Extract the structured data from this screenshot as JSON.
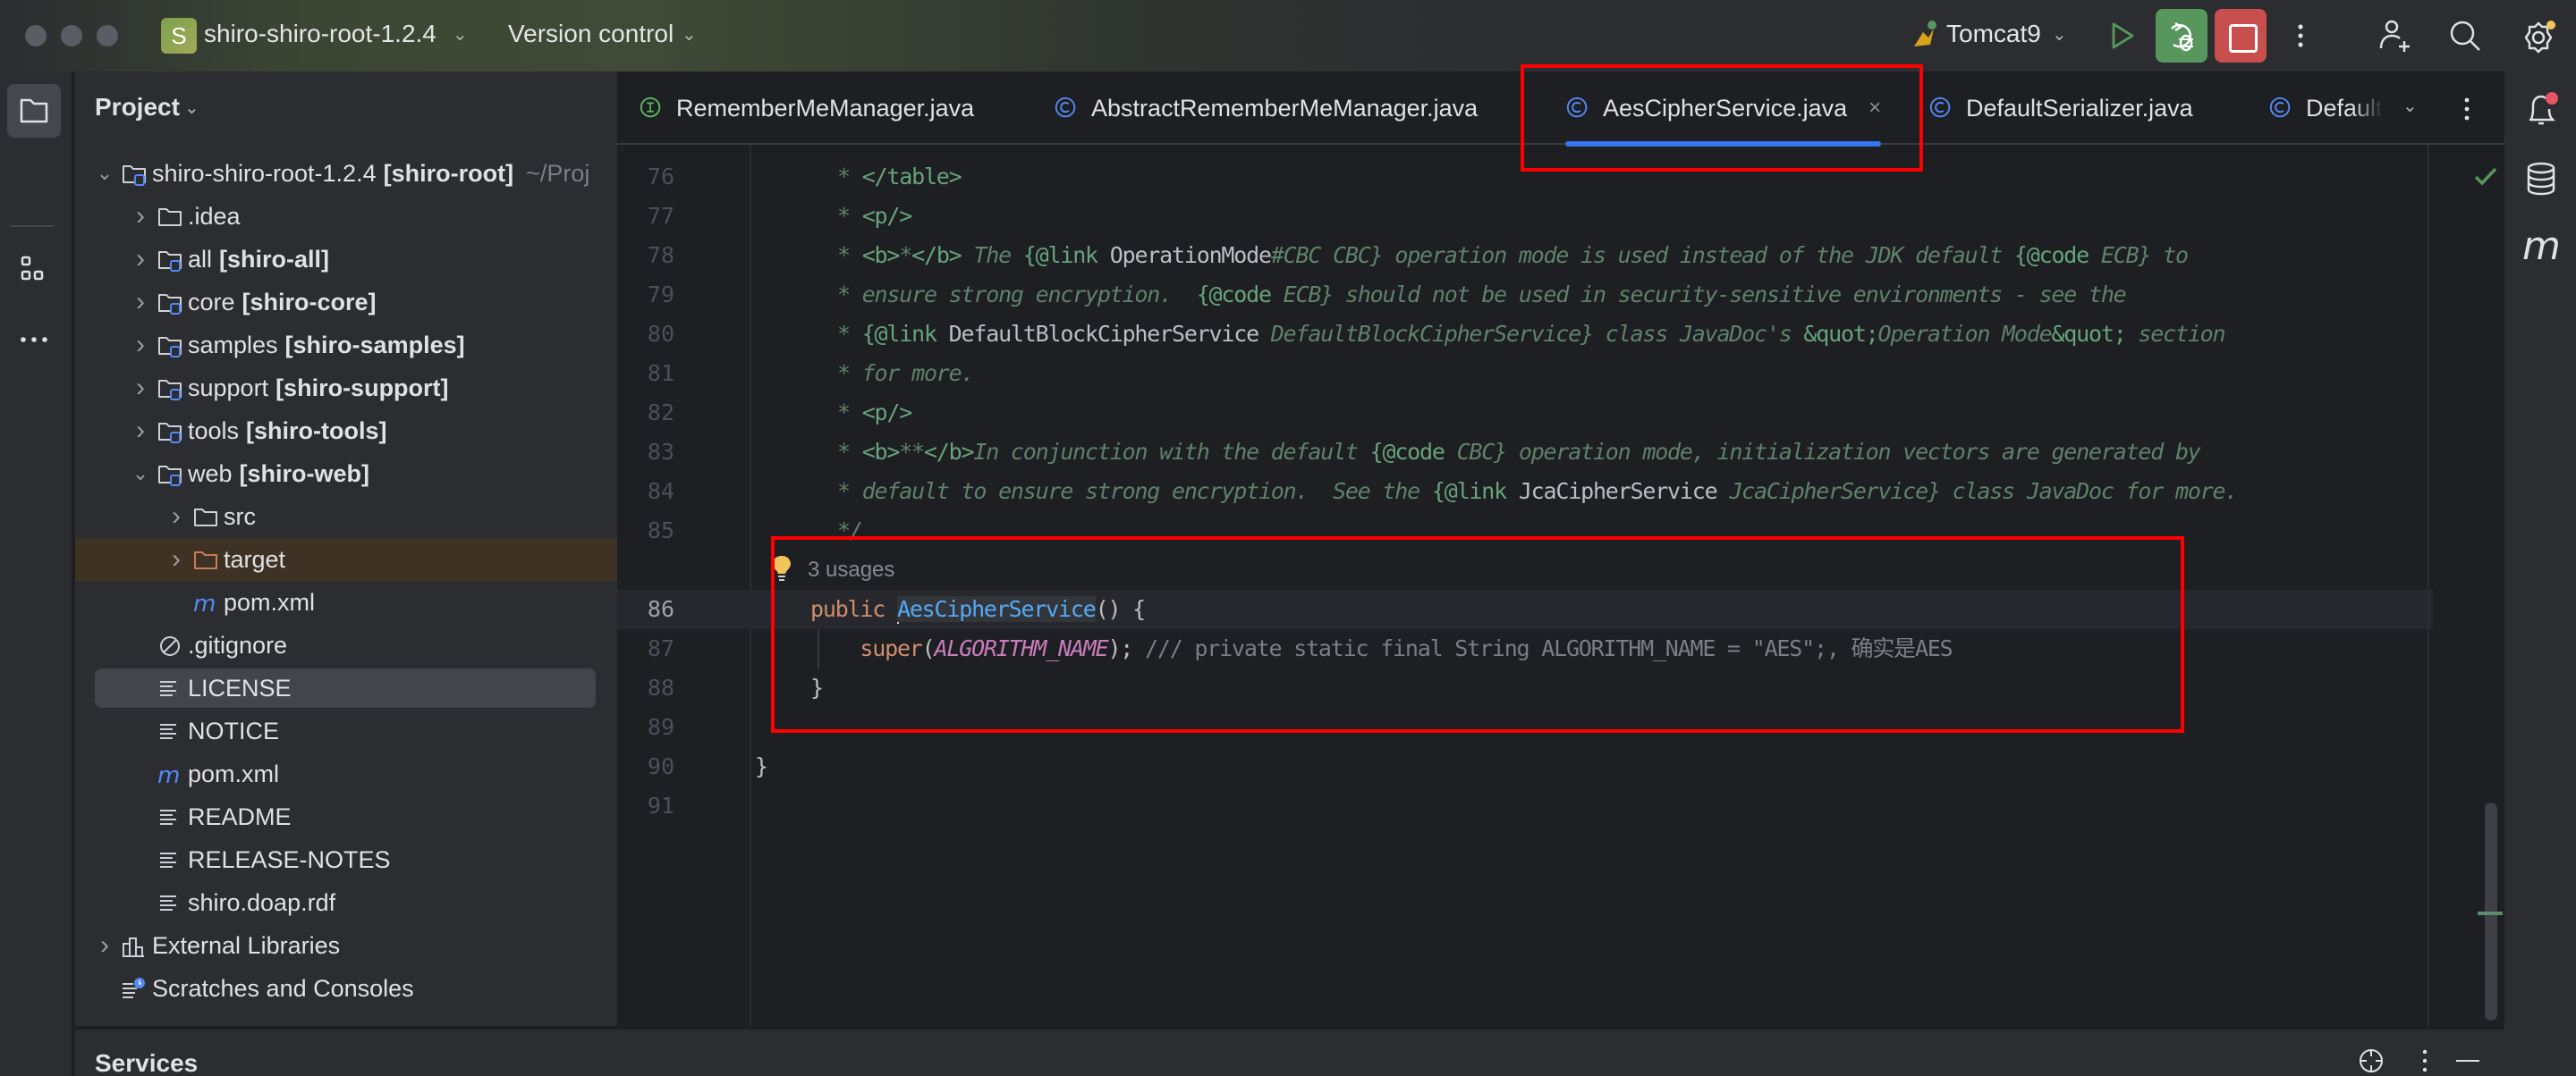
{
  "titlebar": {
    "project_badge": "S",
    "project_name": "shiro-shiro-root-1.2.4",
    "version_control": "Version control",
    "run_config": "Tomcat9",
    "colors": {
      "debug": "#57965c",
      "stop": "#c94f4f",
      "run": "#57965c"
    }
  },
  "left_strip": {
    "items": [
      {
        "icon": "folder-icon",
        "label": "Project",
        "active": true
      },
      {
        "icon": "structure-icon",
        "label": "Structure"
      },
      {
        "icon": "more-icon",
        "label": "More tool windows"
      }
    ]
  },
  "project_panel": {
    "title": "Project",
    "tree": [
      {
        "level": 0,
        "expanded": true,
        "icon": "module-folder",
        "name": "shiro-shiro-root-1.2.4",
        "module": "[shiro-root]",
        "path": "~/Proj"
      },
      {
        "level": 1,
        "expanded": false,
        "icon": "folder",
        "name": ".idea"
      },
      {
        "level": 1,
        "expanded": false,
        "icon": "module-folder",
        "name": "all",
        "module": "[shiro-all]"
      },
      {
        "level": 1,
        "expanded": false,
        "icon": "module-folder",
        "name": "core",
        "module": "[shiro-core]"
      },
      {
        "level": 1,
        "expanded": false,
        "icon": "module-folder",
        "name": "samples",
        "module": "[shiro-samples]"
      },
      {
        "level": 1,
        "expanded": false,
        "icon": "module-folder",
        "name": "support",
        "module": "[shiro-support]"
      },
      {
        "level": 1,
        "expanded": false,
        "icon": "module-folder",
        "name": "tools",
        "module": "[shiro-tools]"
      },
      {
        "level": 1,
        "expanded": true,
        "icon": "module-folder",
        "name": "web",
        "module": "[shiro-web]"
      },
      {
        "level": 2,
        "expanded": false,
        "icon": "folder",
        "name": "src"
      },
      {
        "level": 2,
        "expanded": false,
        "icon": "excluded-folder",
        "name": "target",
        "excluded": true
      },
      {
        "level": 2,
        "icon": "maven",
        "name": "pom.xml"
      },
      {
        "level": 1,
        "icon": "ignore",
        "name": ".gitignore"
      },
      {
        "level": 1,
        "icon": "text",
        "name": "LICENSE",
        "selected": true
      },
      {
        "level": 1,
        "icon": "text",
        "name": "NOTICE"
      },
      {
        "level": 1,
        "icon": "maven",
        "name": "pom.xml"
      },
      {
        "level": 1,
        "icon": "text",
        "name": "README"
      },
      {
        "level": 1,
        "icon": "text",
        "name": "RELEASE-NOTES"
      },
      {
        "level": 1,
        "icon": "text",
        "name": "shiro.doap.rdf"
      },
      {
        "level": 0,
        "expanded": false,
        "icon": "libraries",
        "name": "External Libraries"
      },
      {
        "level": 0,
        "icon": "scratches",
        "name": "Scratches and Consoles"
      }
    ]
  },
  "editor": {
    "tabs": [
      {
        "label": "RememberMeManager.java",
        "kind": "interface"
      },
      {
        "label": "AbstractRememberMeManager.java",
        "kind": "class"
      },
      {
        "label": "AesCipherService.java",
        "kind": "class",
        "active": true,
        "close": "×"
      },
      {
        "label": "DefaultSerializer.java",
        "kind": "class"
      },
      {
        "label": "Default",
        "kind": "class",
        "truncated": true
      }
    ],
    "usages_hint": "3 usages",
    "lines": [
      {
        "n": "76",
        "segs": [
          [
            "doc",
            "* "
          ],
          [
            "doctag",
            "</table>"
          ]
        ]
      },
      {
        "n": "77",
        "segs": [
          [
            "doc",
            "* "
          ],
          [
            "doctag",
            "<p/>"
          ]
        ]
      },
      {
        "n": "78",
        "segs": [
          [
            "doc",
            "* "
          ],
          [
            "doctag",
            "<b>"
          ],
          [
            "doc",
            "*"
          ],
          [
            "doctag",
            "</b>"
          ],
          [
            "doc",
            " The "
          ],
          [
            "doctag",
            "{@link"
          ],
          [
            "docref",
            " OperationMode"
          ],
          [
            "doc",
            "#CBC CBC} operation mode is used instead of the JDK default "
          ],
          [
            "doctag",
            "{@code"
          ],
          [
            "doc",
            " ECB} to"
          ]
        ]
      },
      {
        "n": "79",
        "segs": [
          [
            "doc",
            "* ensure strong encryption.  "
          ],
          [
            "doctag",
            "{@code"
          ],
          [
            "doc",
            " ECB} should not be used in security-sensitive environments - see the"
          ]
        ]
      },
      {
        "n": "80",
        "segs": [
          [
            "doc",
            "* "
          ],
          [
            "doctag",
            "{@link"
          ],
          [
            "docref",
            " DefaultBlockCipherService"
          ],
          [
            "doc",
            " DefaultBlockCipherService} class JavaDoc's "
          ],
          [
            "doctag",
            "&quot;"
          ],
          [
            "doc",
            "Operation Mode"
          ],
          [
            "doctag",
            "&quot;"
          ],
          [
            "doc",
            " section"
          ]
        ]
      },
      {
        "n": "81",
        "segs": [
          [
            "doc",
            "* for more."
          ]
        ]
      },
      {
        "n": "82",
        "segs": [
          [
            "doc",
            "* "
          ],
          [
            "doctag",
            "<p/>"
          ]
        ]
      },
      {
        "n": "83",
        "segs": [
          [
            "doc",
            "* "
          ],
          [
            "doctag",
            "<b>"
          ],
          [
            "doc",
            "**"
          ],
          [
            "doctag",
            "</b>"
          ],
          [
            "doc",
            "In conjunction with the default "
          ],
          [
            "doctag",
            "{@code"
          ],
          [
            "doc",
            " CBC} operation mode, initialization vectors are generated by"
          ]
        ]
      },
      {
        "n": "84",
        "segs": [
          [
            "doc",
            "* default to ensure strong encryption.  See the "
          ],
          [
            "doctag",
            "{@link"
          ],
          [
            "docref",
            " JcaCipherService"
          ],
          [
            "doc",
            " JcaCipherService} class JavaDoc for more."
          ]
        ]
      },
      {
        "n": "85",
        "segs": [
          [
            "doc",
            "*/"
          ]
        ]
      },
      {
        "n": "86",
        "current": true,
        "segs": [
          [
            "kw",
            "public "
          ],
          [
            "caret",
            ""
          ],
          [
            "fn",
            "AesCipherService"
          ],
          [
            "punc",
            "() {"
          ]
        ]
      },
      {
        "n": "87",
        "segs": [
          [
            "kw",
            "    super"
          ],
          [
            "punc",
            "("
          ],
          [
            "const",
            "ALGORITHM_NAME"
          ],
          [
            "punc",
            "); "
          ],
          [
            "cmt",
            "/// private static final String ALGORITHM_NAME = \"AES\";, 确实是AES"
          ]
        ]
      },
      {
        "n": "88",
        "segs": [
          [
            "punc",
            "}"
          ]
        ]
      },
      {
        "n": "89",
        "segs": []
      },
      {
        "n": "90",
        "segs": [
          [
            "punc",
            "}"
          ]
        ]
      },
      {
        "n": "91",
        "segs": []
      }
    ],
    "colors": {
      "doc_comment": "#5f826b",
      "doc_tag": "#67a37c",
      "keyword": "#cf8e6d",
      "method": "#56a8f5",
      "constant": "#c77dbb",
      "comment": "#7a7e85",
      "active_tab_underline": "#3574f0",
      "annotation_box": "#ff0000"
    }
  },
  "services": {
    "label": "Services"
  }
}
